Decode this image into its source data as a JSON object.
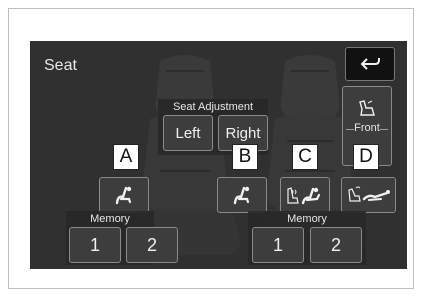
{
  "screen": {
    "title": "Seat"
  },
  "seat_adjustment": {
    "label": "Seat Adjustment",
    "left_label": "Left",
    "right_label": "Right"
  },
  "front": {
    "label": "Front"
  },
  "memory_left": {
    "label": "Memory",
    "button_1": "1",
    "button_2": "2"
  },
  "memory_right": {
    "label": "Memory",
    "button_1": "1",
    "button_2": "2"
  },
  "callouts": {
    "a": "A",
    "b": "B",
    "c": "C",
    "d": "D"
  },
  "icons": {
    "back": "back-arrow-icon",
    "seat_position": "seat-position-icon",
    "seat_heater": "seat-heater-icon",
    "seat_recline": "seat-recline-icon",
    "front_seat": "front-seat-icon"
  }
}
